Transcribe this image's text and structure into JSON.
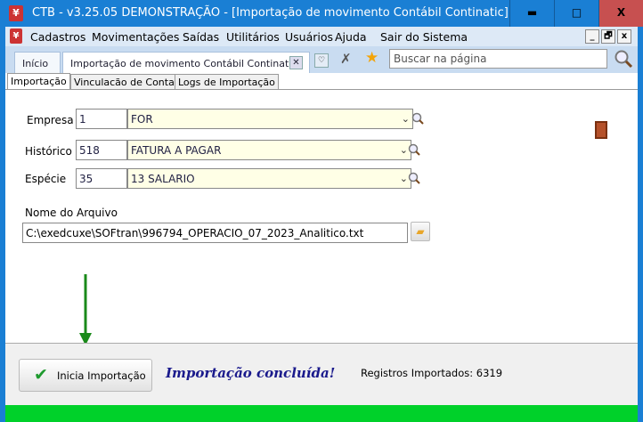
{
  "window": {
    "title": "CTB - v3.25.05   DEMONSTRAÇÃO - [Importação de movimento Contábil Continatic]",
    "minimize": "▬",
    "maximize": "□",
    "close": "X"
  },
  "menu": {
    "items": [
      "Cadastros",
      "Movimentações",
      "Saídas",
      "Utilitários",
      "Usuários",
      "Ajuda",
      "Sair do Sistema"
    ],
    "mdi": [
      "_",
      "🗗",
      "x"
    ]
  },
  "tabs": {
    "home": "Início",
    "active": "Importação de movimento Contábil Continatic"
  },
  "search": {
    "placeholder": "Buscar na página"
  },
  "subtabs": [
    "Importação",
    "Vinculacão de Contas",
    "Logs de Importação"
  ],
  "form": {
    "empresa": {
      "label": "Empresa",
      "code": "1",
      "desc": "FOR"
    },
    "historico": {
      "label": "Histórico",
      "code": "518",
      "desc": "FATURA A PAGAR"
    },
    "especie": {
      "label": "Espécie",
      "code": "35",
      "desc": "13 SALARIO"
    },
    "arquivo": {
      "label": "Nome do Arquivo",
      "value": "C:\\exedcuxe\\SOFtran\\996794_OPERACIO_07_2023_Analitico.txt"
    }
  },
  "footer": {
    "button": "Inicia Importação",
    "status": "Importação concluída!",
    "records": "Registros Importados: 6319",
    "progress_percent": 100
  },
  "colors": {
    "titlebar": "#1a7fd4",
    "close": "#c75050",
    "progress": "#00d12a",
    "status": "#1a1a8c"
  }
}
